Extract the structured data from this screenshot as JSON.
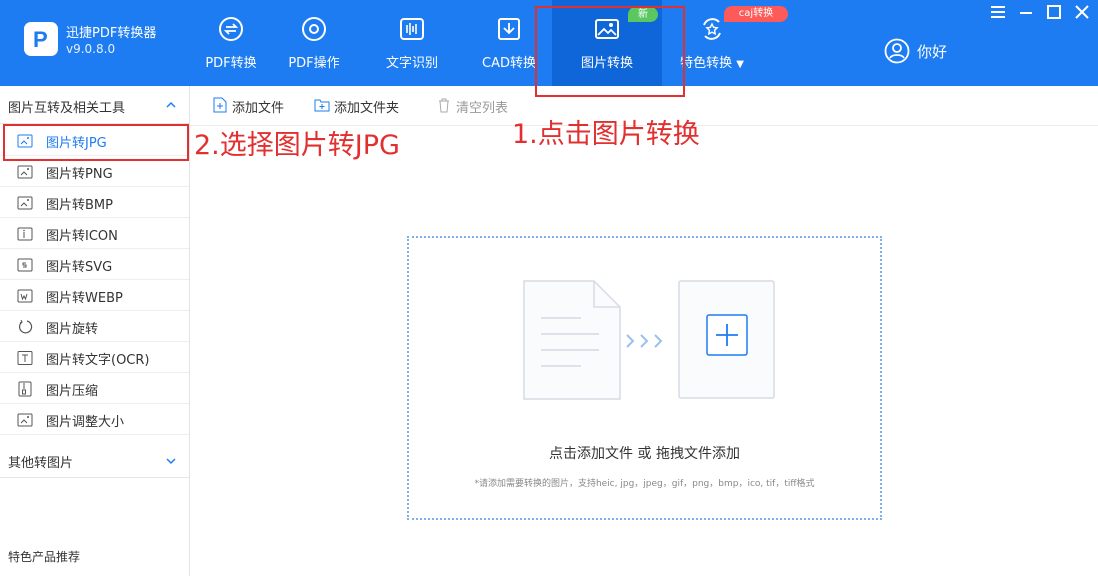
{
  "app": {
    "name": "迅捷PDF转换器",
    "version": "v9.0.8.0",
    "logo_letter": "P"
  },
  "nav": [
    {
      "label": "PDF转换",
      "icon": "pdf-convert-icon"
    },
    {
      "label": "PDF操作",
      "icon": "pdf-operation-icon"
    },
    {
      "label": "文字识别",
      "icon": "ocr-icon"
    },
    {
      "label": "CAD转换",
      "icon": "cad-icon"
    },
    {
      "label": "图片转换",
      "icon": "image-icon",
      "active": true,
      "badge": "新"
    },
    {
      "label": "特色转换",
      "icon": "special-icon",
      "badge": "caj转换"
    }
  ],
  "user": {
    "label": "你好"
  },
  "sidebar": {
    "group_title": "图片互转及相关工具",
    "items": [
      {
        "label": "图片转JPG",
        "icon": "jpg-icon",
        "active": true
      },
      {
        "label": "图片转PNG",
        "icon": "png-icon"
      },
      {
        "label": "图片转BMP",
        "icon": "bmp-icon"
      },
      {
        "label": "图片转ICON",
        "icon": "icon-file-icon"
      },
      {
        "label": "图片转SVG",
        "icon": "svg-icon"
      },
      {
        "label": "图片转WEBP",
        "icon": "webp-icon"
      },
      {
        "label": "图片旋转",
        "icon": "rotate-icon"
      },
      {
        "label": "图片转文字(OCR)",
        "icon": "text-ocr-icon"
      },
      {
        "label": "图片压缩",
        "icon": "compress-icon"
      },
      {
        "label": "图片调整大小",
        "icon": "resize-icon"
      }
    ],
    "other_group": "其他转图片",
    "footer": "特色产品推荐"
  },
  "toolbar": {
    "add_file": "添加文件",
    "add_folder": "添加文件夹",
    "clear_list": "清空列表"
  },
  "dropzone": {
    "main": "点击添加文件 或 拖拽文件添加",
    "hint": "*请添加需要转换的图片，支持heic, jpg，jpeg，gif，png，bmp，ico, tif，tiff格式"
  },
  "annotations": {
    "step1": "1.点击图片转换",
    "step2": "2.选择图片转JPG"
  },
  "colors": {
    "header": "#1d7cf2",
    "active_nav": "#0f66d8",
    "annotation": "#e23030",
    "accent": "#1d7cf2"
  }
}
